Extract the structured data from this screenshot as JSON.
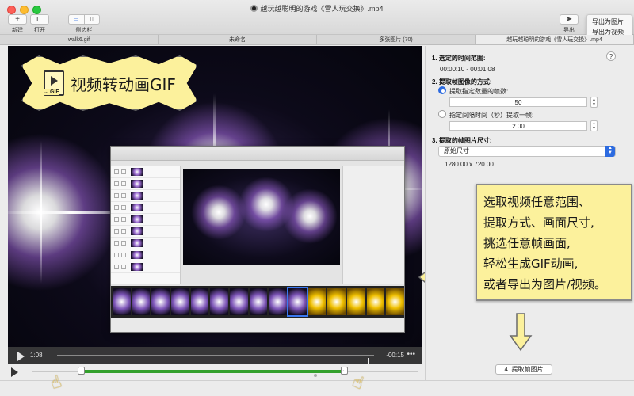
{
  "window": {
    "title": "越玩越聪明的游戏《雪人玩交换》.mp4"
  },
  "toolbar": {
    "new_label": "新建",
    "open_label": "打开",
    "sidebar_label": "侧边栏",
    "export_label": "导出"
  },
  "export_menu": {
    "items": [
      "导出为图片",
      "导出为视频"
    ]
  },
  "tabs": [
    {
      "label": "walk6.gif"
    },
    {
      "label": "未命名"
    },
    {
      "label": "多张图片 (70)"
    },
    {
      "label": "越玩越聪明的游戏《雪人玩交换》.mp4",
      "active": true
    }
  ],
  "callout": {
    "icon_label": "→ GIF",
    "text": "视频转动画GIF"
  },
  "player": {
    "current_time": "1:08",
    "remaining_time": "-00:15",
    "dots": "•••",
    "position": 0.98
  },
  "range": {
    "start_handle": "→",
    "end_handle": "←",
    "start": 0.13,
    "end": 0.81
  },
  "panel": {
    "sec1_title": "1. 选定的时间范围:",
    "help_label": "?",
    "time_range": "00:00:10 - 00:01:08",
    "sec2_title": "2. 提取帧图像的方式:",
    "opt_count_label": "提取指定数量的帧数:",
    "opt_count_value": "50",
    "opt_interval_label": "指定间隔时间（秒）提取一帧:",
    "opt_interval_value": "2.00",
    "selected_option": "count",
    "sec3_title": "3. 提取的帧图片尺寸:",
    "size_select": "原始尺寸",
    "size_value": "1280.00 x 720.00",
    "extract_button": "4. 提取帧图片"
  },
  "note": {
    "lines": [
      "选取视频任意范围、",
      "提取方式、画面尺寸,",
      "挑选任意帧画面,",
      "轻松生成GIF动画,",
      "或者导出为图片/视频。"
    ]
  },
  "colors": {
    "note_bg": "#fcf19c",
    "accent_blue": "#2d6be0",
    "range_green": "#33a02c"
  }
}
